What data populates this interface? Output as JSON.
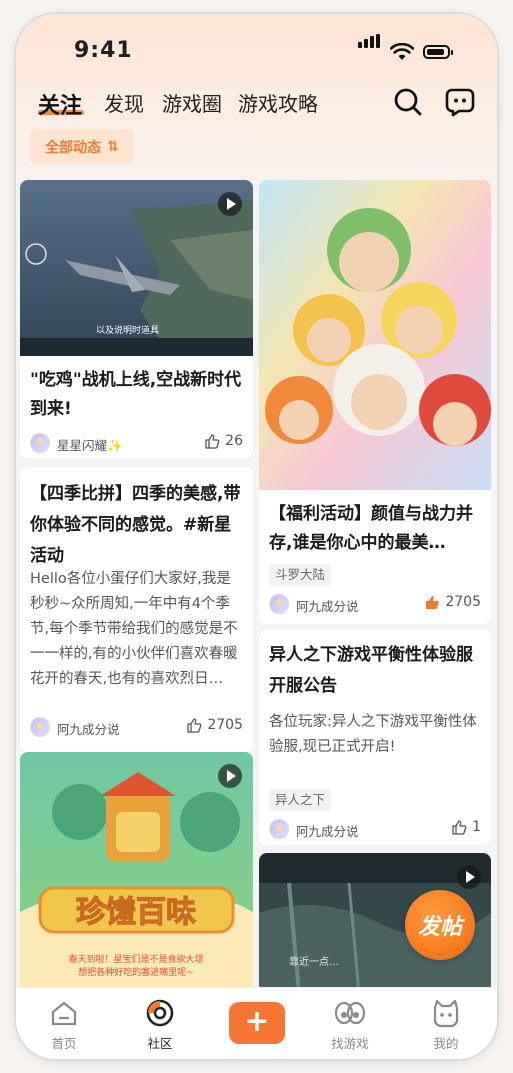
{
  "status_bar": {
    "time": "9:41"
  },
  "nav": {
    "tabs": [
      "关注",
      "发现",
      "游戏圈",
      "游戏攻略"
    ]
  },
  "filter": {
    "label": "全部动态",
    "icon": "⇅"
  },
  "feed": {
    "left": [
      {
        "type": "video",
        "overlay_text": "以及说明时道具",
        "title": "\"吃鸡\"战机上线,空战新时代到来!",
        "user": "星星闪耀✨",
        "likes": "26"
      },
      {
        "type": "text",
        "title": "【四季比拼】四季的美感,带你体验不同的感觉。#新星活动",
        "body": "Hello各位小蛋仔们大家好,我是秒秒~众所周知,一年中有4个季节,每个季节带给我们的感觉是不一一样的,有的小伙伴们喜欢春暖花开的春天,也有的喜欢烈日…",
        "user": "阿九成分说",
        "likes": "2705"
      },
      {
        "type": "video",
        "banner_text": "珍馐百味",
        "lines": [
          "春天到啦！星宝们是不是食欲大增",
          "想把各种好吃的塞进嘴里呢~"
        ]
      }
    ],
    "right": [
      {
        "type": "image",
        "title": "【福利活动】颜值与战力并存,谁是你心中的最美…",
        "tag": "斗罗大陆",
        "user": "阿九成分说",
        "likes": "2705"
      },
      {
        "type": "text",
        "title": "异人之下游戏平衡性体验服开服公告",
        "body": "各位玩家:异人之下游戏平衡性体验服,现已正式开启!",
        "tag": "异人之下",
        "user": "阿九成分说",
        "likes": "1"
      },
      {
        "type": "video",
        "overlay_text": "靠近一点…"
      }
    ]
  },
  "float_button": {
    "label": "发帖"
  },
  "tabbar": {
    "items": [
      "首页",
      "社区",
      "+",
      "找游戏",
      "我的"
    ],
    "active": "社区"
  },
  "colors": {
    "accent": "#f47a2b",
    "chip_bg": "#fde4d1"
  }
}
